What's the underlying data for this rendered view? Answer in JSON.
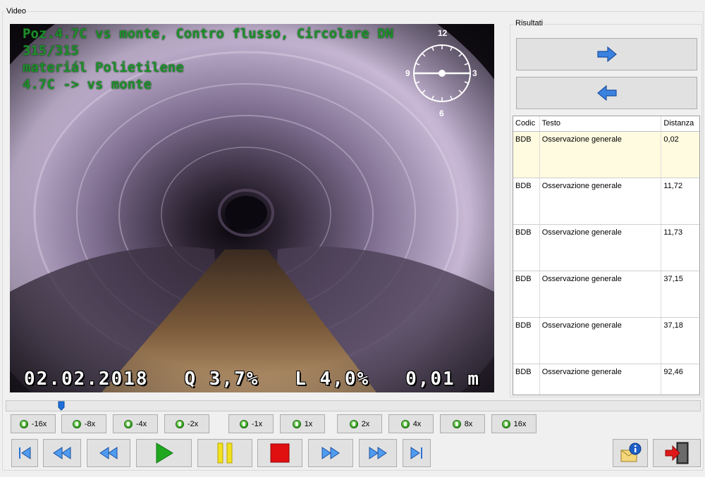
{
  "video_group": {
    "label": "Video"
  },
  "osd": {
    "lines": [
      "Poz.4.7C vs monte,  Contro flusso, Circolare DN",
      "315/315",
      "materiál Polietilene",
      "4.7C -> vs monte"
    ],
    "date": "02.02.2018",
    "q": "Q  3,7%",
    "l": "L  4,0%",
    "distance": "0,01 m",
    "clock": {
      "top": "12",
      "right": "3",
      "bottom": "6",
      "left": "9"
    }
  },
  "results_group": {
    "label": "Risultati"
  },
  "results": {
    "columns": [
      "Codic",
      "Testo",
      "Distanza"
    ],
    "rows": [
      {
        "code": "BDB",
        "text": "Osservazione generale",
        "distance": "0,02",
        "selected": true
      },
      {
        "code": "BDB",
        "text": "Osservazione generale",
        "distance": "11,72"
      },
      {
        "code": "BDB",
        "text": "Osservazione generale",
        "distance": "11,73"
      },
      {
        "code": "BDB",
        "text": "Osservazione generale",
        "distance": "37,15"
      },
      {
        "code": "BDB",
        "text": "Osservazione generale",
        "distance": "37,18"
      },
      {
        "code": "BDB",
        "text": "Osservazione generale",
        "distance": "92,46"
      }
    ]
  },
  "slider": {
    "position": 0.08
  },
  "speeds": [
    "-16x",
    "-8x",
    "-4x",
    "-2x",
    "-1x",
    "1x",
    "2x",
    "4x",
    "8x",
    "16x"
  ],
  "colors": {
    "osd_text": "#1c8f2a",
    "play": "#1fa81f",
    "pause": "#f2e21e",
    "stop": "#e01010",
    "nav_blue": "#2b73d6"
  }
}
